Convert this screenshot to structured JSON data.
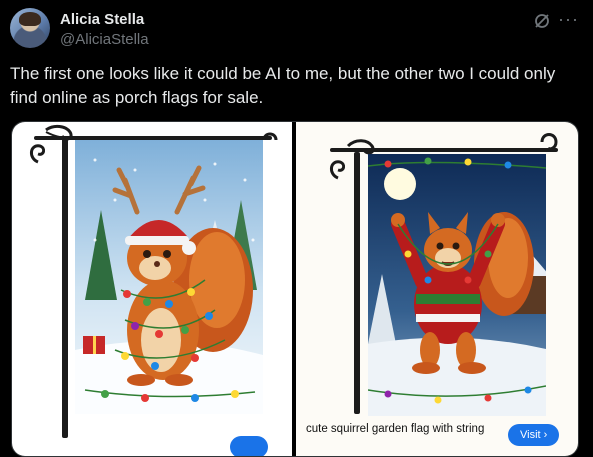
{
  "post": {
    "author_name": "Alicia Stella",
    "author_handle": "@AliciaStella",
    "text": "The first one looks like it could be AI to me, but the other two I could only find online as porch flags for sale."
  },
  "icons": {
    "grok": "grok-icon",
    "more": "more-icon",
    "visit_arrow": "chevron-right-icon"
  },
  "media": {
    "left": {
      "caption": "",
      "visit_label": ""
    },
    "right": {
      "caption": "cute squirrel garden flag with string",
      "visit_label": "Visit ›"
    }
  },
  "colors": {
    "background": "#000000",
    "text": "#e7e9ea",
    "secondary_text": "#71767b",
    "visit_button": "#1a73e8"
  }
}
